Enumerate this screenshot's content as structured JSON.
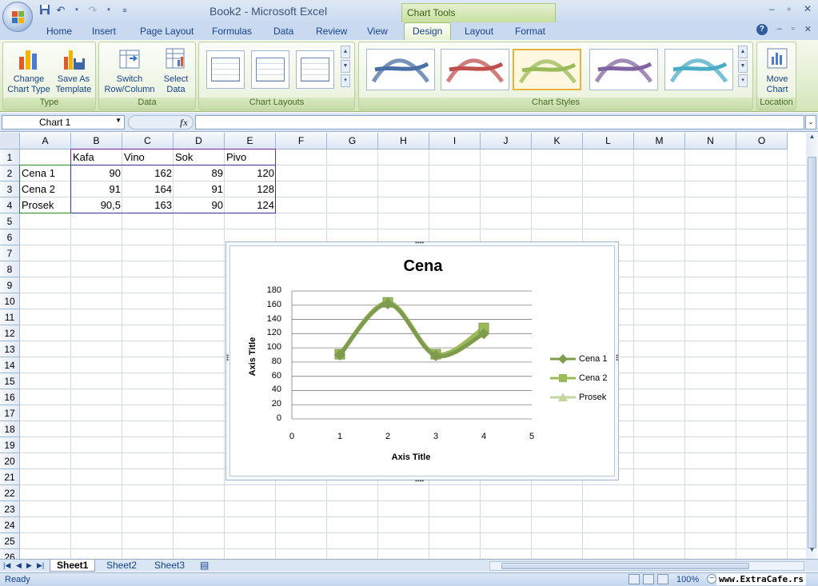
{
  "titlebar": {
    "title": "Book2 - Microsoft Excel",
    "context_tab_group": "Chart Tools",
    "min": "–",
    "restore": "▫",
    "close": "✕"
  },
  "tabs": [
    {
      "label": "Home"
    },
    {
      "label": "Insert"
    },
    {
      "label": "Page Layout"
    },
    {
      "label": "Formulas"
    },
    {
      "label": "Data"
    },
    {
      "label": "Review"
    },
    {
      "label": "View"
    },
    {
      "label": "Design",
      "active": true
    },
    {
      "label": "Layout"
    },
    {
      "label": "Format"
    }
  ],
  "ribbon": {
    "groups": {
      "type": "Type",
      "data": "Data",
      "chart_layouts": "Chart Layouts",
      "chart_styles": "Chart Styles",
      "location": "Location"
    },
    "buttons": {
      "change_chart_type_1": "Change",
      "change_chart_type_2": "Chart Type",
      "save_as_template_1": "Save As",
      "save_as_template_2": "Template",
      "switch_row_col_1": "Switch",
      "switch_row_col_2": "Row/Column",
      "select_data_1": "Select",
      "select_data_2": "Data",
      "move_chart_1": "Move",
      "move_chart_2": "Chart"
    },
    "style_colors": [
      "#4a6fa5",
      "#c0504d",
      "#9bbb59",
      "#8064a2",
      "#4bacc6"
    ],
    "selected_style_index": 2
  },
  "formula_bar": {
    "name_box": "Chart 1",
    "fx": "fx",
    "formula": ""
  },
  "sheet": {
    "columns": [
      "A",
      "B",
      "C",
      "D",
      "E",
      "F",
      "G",
      "H",
      "I",
      "J",
      "K",
      "L",
      "M",
      "N",
      "O"
    ],
    "rows": [
      "1",
      "2",
      "3",
      "4",
      "5",
      "6",
      "7",
      "8",
      "9",
      "10",
      "11",
      "12",
      "13",
      "14",
      "15",
      "16",
      "17",
      "18",
      "19",
      "20",
      "21",
      "22",
      "23",
      "24",
      "25",
      "26"
    ],
    "header_row": [
      "",
      "Kafa",
      "Vino",
      "Sok",
      "Pivo"
    ],
    "data_rows": [
      [
        "Cena 1",
        "90",
        "162",
        "89",
        "120"
      ],
      [
        "Cena 2",
        "91",
        "164",
        "91",
        "128"
      ],
      [
        "Prosek",
        "90,5",
        "163",
        "90",
        "124"
      ]
    ],
    "tabs": [
      {
        "label": "Sheet1",
        "active": true
      },
      {
        "label": "Sheet2"
      },
      {
        "label": "Sheet3"
      }
    ]
  },
  "chart_data": {
    "type": "line",
    "title": "Cena",
    "xlabel": "Axis Title",
    "ylabel": "Axis Title",
    "x_ticks": [
      "0",
      "1",
      "2",
      "3",
      "4",
      "5"
    ],
    "y_ticks": [
      "180",
      "160",
      "140",
      "120",
      "100",
      "80",
      "60",
      "40",
      "20",
      "0"
    ],
    "xlim": [
      0,
      5
    ],
    "ylim": [
      0,
      180
    ],
    "grid": true,
    "legend_position": "right",
    "x": [
      1,
      2,
      3,
      4
    ],
    "series": [
      {
        "name": "Cena 1",
        "values": [
          90,
          162,
          89,
          120
        ],
        "marker": "diamond",
        "color": "#7f9b4e"
      },
      {
        "name": "Cena 2",
        "values": [
          91,
          164,
          91,
          128
        ],
        "marker": "square",
        "color": "#9bbb59"
      },
      {
        "name": "Prosek",
        "values": [
          90.5,
          163,
          90,
          124
        ],
        "marker": "triangle",
        "color": "#c3d69b"
      }
    ]
  },
  "status": {
    "text": "Ready",
    "zoom": "100%",
    "watermark": "www.ExtraCafe.rs"
  }
}
